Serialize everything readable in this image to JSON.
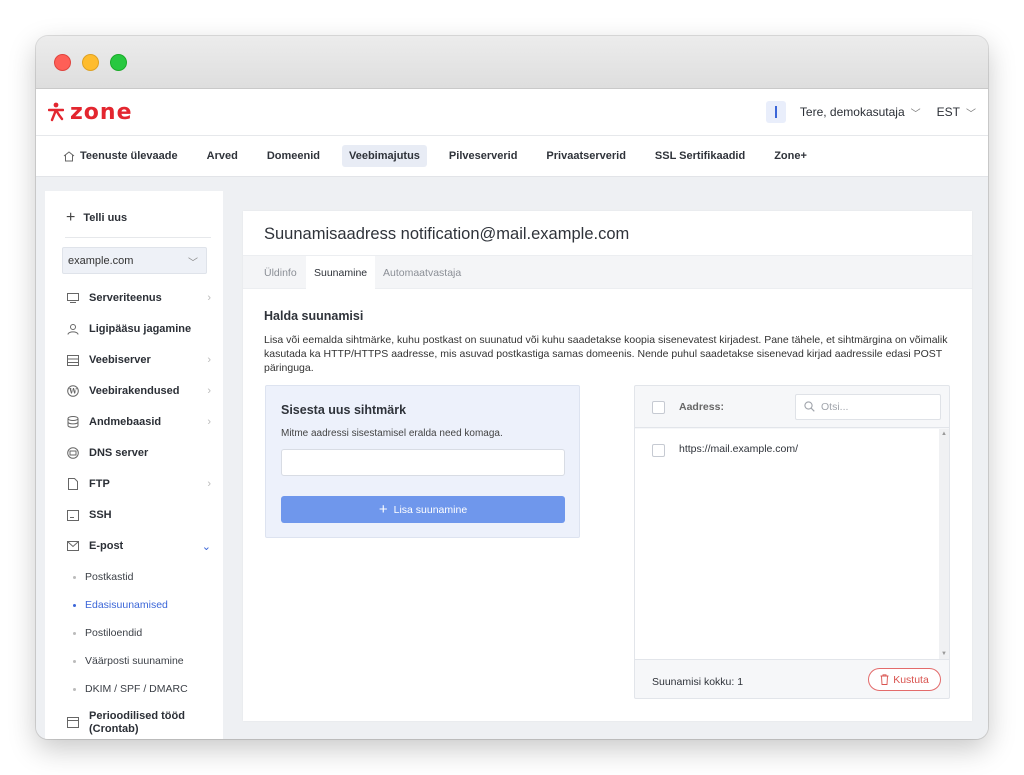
{
  "header": {
    "logo_text": "zone",
    "greeting": "Tere, demokasutaja",
    "language": "EST"
  },
  "topnav": {
    "items": [
      {
        "label": "Teenuste ülevaade"
      },
      {
        "label": "Arved"
      },
      {
        "label": "Domeenid"
      },
      {
        "label": "Veebimajutus"
      },
      {
        "label": "Pilveserverid"
      },
      {
        "label": "Privaatserverid"
      },
      {
        "label": "SSL Sertifikaadid"
      },
      {
        "label": "Zone+"
      }
    ],
    "active": "Veebimajutus"
  },
  "sidebar": {
    "order_label": "Telli uus",
    "domain": "example.com",
    "items": [
      {
        "label": "Serveriteenus",
        "icon": "server-icon"
      },
      {
        "label": "Ligipääsu jagamine",
        "icon": "user-icon"
      },
      {
        "label": "Veebiserver",
        "icon": "webserver-icon"
      },
      {
        "label": "Veebirakendused",
        "icon": "wordpress-icon"
      },
      {
        "label": "Andmebaasid",
        "icon": "database-icon"
      },
      {
        "label": "DNS server",
        "icon": "dns-icon"
      },
      {
        "label": "FTP",
        "icon": "file-icon"
      },
      {
        "label": "SSH",
        "icon": "terminal-icon"
      },
      {
        "label": "E-post",
        "icon": "mail-icon"
      },
      {
        "label": "Perioodilised tööd (Crontab)",
        "icon": "calendar-icon"
      }
    ],
    "email_subitems": [
      {
        "label": "Postkastid"
      },
      {
        "label": "Edasisuunamised"
      },
      {
        "label": "Postiloendid"
      },
      {
        "label": "Väärposti suunamine"
      },
      {
        "label": "DKIM / SPF / DMARC"
      }
    ],
    "active_subitem": "Edasisuunamised"
  },
  "main": {
    "title": "Suunamisaadress notification@mail.example.com",
    "tabs": [
      {
        "label": "Üldinfo"
      },
      {
        "label": "Suunamine"
      },
      {
        "label": "Automaatvastaja"
      }
    ],
    "active_tab": "Suunamine",
    "section_title": "Halda suunamisi",
    "description": "Lisa või eemalda sihtmärke, kuhu postkast on suunatud või kuhu saadetakse koopia sisenevatest kirjadest. Pane tähele, et sihtmärgina on võimalik kasutada ka HTTP/HTTPS aadresse, mis asuvad postkastiga samas domeenis. Nende puhul saadetakse sisenevad kirjad aadressile edasi POST päringuga.",
    "new_target": {
      "heading": "Sisesta uus sihtmärk",
      "hint": "Mitme aadressi sisestamisel eralda need komaga.",
      "input_value": "",
      "add_button": "Lisa suunamine"
    },
    "list": {
      "column_label": "Aadress:",
      "search_placeholder": "Otsi...",
      "rows": [
        {
          "address": "https://mail.example.com/"
        }
      ],
      "total_label": "Suunamisi kokku: 1",
      "delete_button": "Kustuta"
    }
  },
  "colors": {
    "brand_red": "#e3262f",
    "accent_blue": "#3b66d8",
    "button_blue": "#6f97ec",
    "danger": "#d9534f"
  }
}
